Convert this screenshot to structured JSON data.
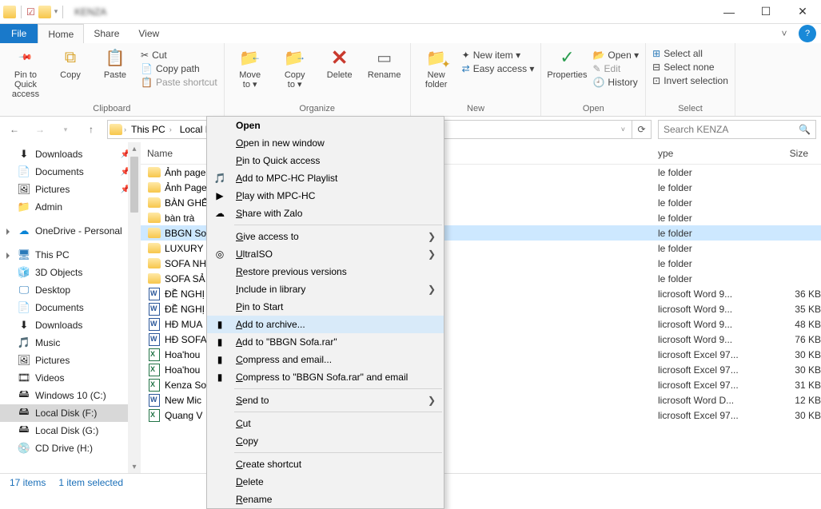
{
  "window": {
    "title": "KENZA"
  },
  "menubar": {
    "file": "File",
    "tabs": [
      "Home",
      "Share",
      "View"
    ],
    "active": 0
  },
  "ribbon": {
    "clipboard": {
      "pin": "Pin to Quick\naccess",
      "copy": "Copy",
      "paste": "Paste",
      "cut": "Cut",
      "copypath": "Copy path",
      "pasteshortcut": "Paste shortcut",
      "label": "Clipboard"
    },
    "organize": {
      "moveto": "Move\nto ▾",
      "copyto": "Copy\nto ▾",
      "delete": "Delete",
      "rename": "Rename",
      "label": "Organize"
    },
    "new": {
      "newfolder": "New\nfolder",
      "newitem": "New item ▾",
      "easyaccess": "Easy access ▾",
      "label": "New"
    },
    "open": {
      "properties": "Properties",
      "open": "Open ▾",
      "edit": "Edit",
      "history": "History",
      "label": "Open"
    },
    "select": {
      "all": "Select all",
      "none": "Select none",
      "invert": "Invert selection",
      "label": "Select"
    }
  },
  "address": {
    "crumbs": [
      "This PC",
      "Local Disk ("
    ],
    "search_placeholder": "Search KENZA"
  },
  "nav": [
    {
      "label": "Downloads",
      "icon": "download",
      "pinned": true
    },
    {
      "label": "Documents",
      "icon": "doc",
      "pinned": true
    },
    {
      "label": "Pictures",
      "icon": "pic",
      "pinned": true
    },
    {
      "label": "Admin",
      "icon": "folder",
      "pinned": false
    },
    {
      "gap": true
    },
    {
      "label": "OneDrive - Personal",
      "icon": "onedrive",
      "expand": true,
      "color": "#0a84d6"
    },
    {
      "gap": true
    },
    {
      "label": "This PC",
      "icon": "thispc",
      "expand": true,
      "color": "#2a7ab9"
    },
    {
      "label": "3D Objects",
      "icon": "3d"
    },
    {
      "label": "Desktop",
      "icon": "desktop",
      "color": "#2a7ab9"
    },
    {
      "label": "Documents",
      "icon": "doc"
    },
    {
      "label": "Downloads",
      "icon": "download"
    },
    {
      "label": "Music",
      "icon": "music"
    },
    {
      "label": "Pictures",
      "icon": "pic"
    },
    {
      "label": "Videos",
      "icon": "video"
    },
    {
      "label": "Windows 10 (C:)",
      "icon": "drive"
    },
    {
      "label": "Local Disk (F:)",
      "icon": "drive",
      "selected": true
    },
    {
      "label": "Local Disk (G:)",
      "icon": "drive"
    },
    {
      "label": "CD Drive (H:)",
      "icon": "cd"
    },
    {
      "gap": true
    }
  ],
  "columns": {
    "name": "Name",
    "date": "",
    "type": "ype",
    "size": "Size"
  },
  "rows": [
    {
      "name": "Ảnh page",
      "ic": "folder",
      "type": "le folder",
      "size": ""
    },
    {
      "name": "Ảnh Page",
      "ic": "folder",
      "type": "le folder",
      "size": ""
    },
    {
      "name": "BÀN GHẾ",
      "ic": "folder",
      "type": "le folder",
      "size": ""
    },
    {
      "name": "bàn trà",
      "ic": "folder",
      "type": "le folder",
      "size": ""
    },
    {
      "name": "BBGN So",
      "ic": "folder",
      "type": "le folder",
      "size": "",
      "selected": true
    },
    {
      "name": "LUXURY",
      "ic": "folder",
      "type": "le folder",
      "size": ""
    },
    {
      "name": "SOFA NH",
      "ic": "folder",
      "type": "le folder",
      "size": ""
    },
    {
      "name": "SOFA SẢ",
      "ic": "folder",
      "type": "le folder",
      "size": ""
    },
    {
      "name": "ĐỀ NGHỊ",
      "ic": "word",
      "type": "licrosoft Word 9...",
      "size": "36 KB"
    },
    {
      "name": "ĐỀ NGHỊ",
      "ic": "word",
      "type": "licrosoft Word 9...",
      "size": "35 KB"
    },
    {
      "name": "HĐ MUA",
      "ic": "word",
      "type": "licrosoft Word 9...",
      "size": "48 KB"
    },
    {
      "name": "HĐ SOFA",
      "ic": "word",
      "type": "licrosoft Word 9...",
      "size": "76 KB"
    },
    {
      "name": "Hoa'hou",
      "ic": "excel",
      "type": "licrosoft Excel 97...",
      "size": "30 KB"
    },
    {
      "name": "Hoa'hou",
      "ic": "excel",
      "type": "licrosoft Excel 97...",
      "size": "30 KB"
    },
    {
      "name": "Kenza So",
      "ic": "excel",
      "type": "licrosoft Excel 97...",
      "size": "31 KB"
    },
    {
      "name": "New Mic",
      "ic": "word",
      "type": "licrosoft Word D...",
      "size": "12 KB"
    },
    {
      "name": "Quang V",
      "ic": "excel",
      "type": "licrosoft Excel 97...",
      "size": "30 KB"
    }
  ],
  "ctxmenu": [
    {
      "label": "Open",
      "bold": true
    },
    {
      "label": "Open in new window"
    },
    {
      "label": "Pin to Quick access"
    },
    {
      "label": "Add to MPC-HC Playlist",
      "icon": "🎵"
    },
    {
      "label": "Play with MPC-HC",
      "icon": "▶"
    },
    {
      "label": "Share with Zalo",
      "icon": "☁"
    },
    {
      "sep": true
    },
    {
      "label": "Give access to",
      "arrow": true
    },
    {
      "label": "UltraISO",
      "icon": "◎",
      "arrow": true
    },
    {
      "label": "Restore previous versions"
    },
    {
      "label": "Include in library",
      "arrow": true
    },
    {
      "label": "Pin to Start"
    },
    {
      "label": "Add to archive...",
      "icon": "▮",
      "highlight": true
    },
    {
      "label": "Add to \"BBGN Sofa.rar\"",
      "icon": "▮"
    },
    {
      "label": "Compress and email...",
      "icon": "▮"
    },
    {
      "label": "Compress to \"BBGN Sofa.rar\" and email",
      "icon": "▮"
    },
    {
      "sep": true
    },
    {
      "label": "Send to",
      "arrow": true
    },
    {
      "sep": true
    },
    {
      "label": "Cut"
    },
    {
      "label": "Copy"
    },
    {
      "sep": true
    },
    {
      "label": "Create shortcut"
    },
    {
      "label": "Delete"
    },
    {
      "label": "Rename"
    }
  ],
  "status": {
    "items": "17 items",
    "selected": "1 item selected"
  }
}
